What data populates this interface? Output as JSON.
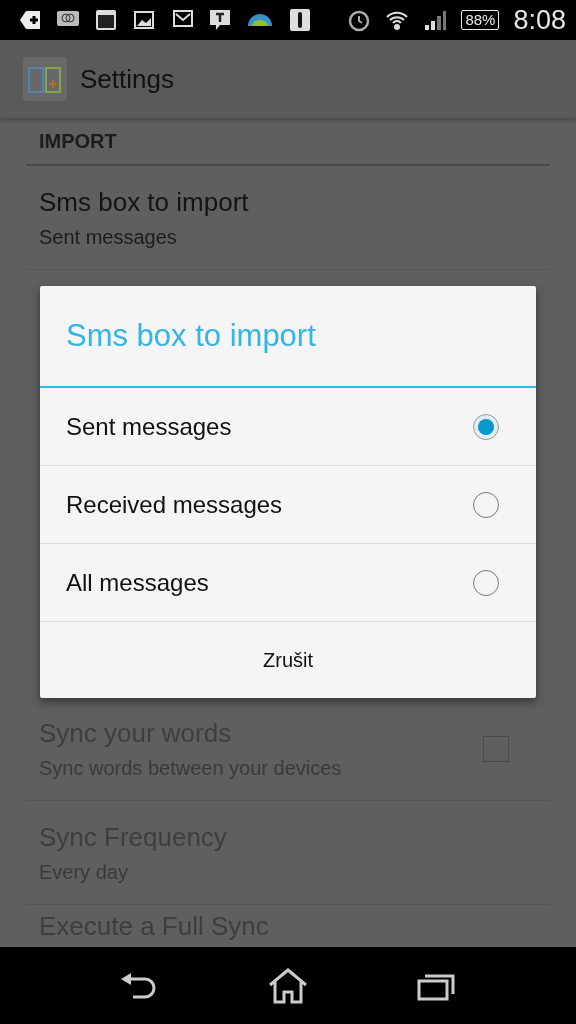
{
  "status_bar": {
    "battery": "88%",
    "time": "8:08"
  },
  "action_bar": {
    "title": "Settings"
  },
  "import_section": {
    "header": "IMPORT",
    "items": [
      {
        "kind": "text",
        "title": "Sms box to import",
        "summary": "Sent messages",
        "disabled": false
      }
    ]
  },
  "sync_items": [
    {
      "kind": "checkbox",
      "title": "Sync your words",
      "summary": "Sync words between your devices",
      "disabled": true,
      "checked": false
    },
    {
      "kind": "text",
      "title": "Sync Frequency",
      "summary": "Every day",
      "disabled": true
    },
    {
      "kind": "text",
      "title": "Execute a Full Sync",
      "disabled": true
    }
  ],
  "dialog": {
    "title": "Sms box to import",
    "options": [
      {
        "label": "Sent messages",
        "selected": true
      },
      {
        "label": "Received messages",
        "selected": false
      },
      {
        "label": "All messages",
        "selected": false
      }
    ],
    "buttons": [
      "Zrušit"
    ]
  }
}
